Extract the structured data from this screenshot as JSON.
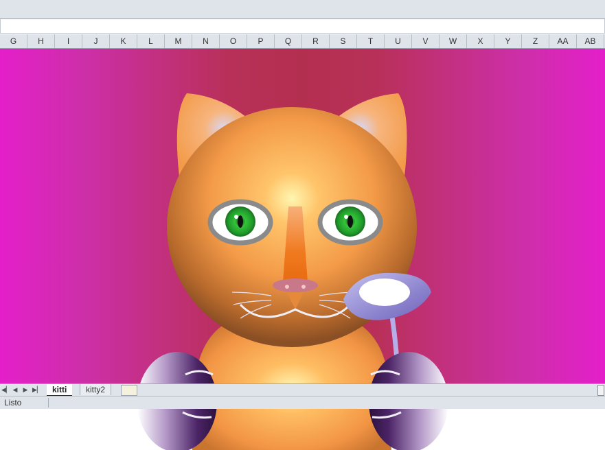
{
  "columns": [
    "G",
    "H",
    "I",
    "J",
    "K",
    "L",
    "M",
    "N",
    "O",
    "P",
    "Q",
    "R",
    "S",
    "T",
    "U",
    "V",
    "W",
    "X",
    "Y",
    "Z",
    "AA",
    "AB"
  ],
  "sheet_tabs": {
    "active": "kitti",
    "inactive": "kitty2"
  },
  "nav_icons": [
    "first-sheet-icon",
    "prev-sheet-icon",
    "next-sheet-icon",
    "last-sheet-icon"
  ],
  "nav_glyphs": [
    "◀▏",
    "◀",
    "▶",
    "▶▏"
  ],
  "status": {
    "text": "Listo"
  },
  "colors": {
    "background_edge": "#e41fca",
    "background_center": "#b32f50",
    "cat_fur": "#f39a48",
    "eye_iris": "#35c43a",
    "flower": "#a49bd6",
    "paws": "#5b2d7a"
  }
}
